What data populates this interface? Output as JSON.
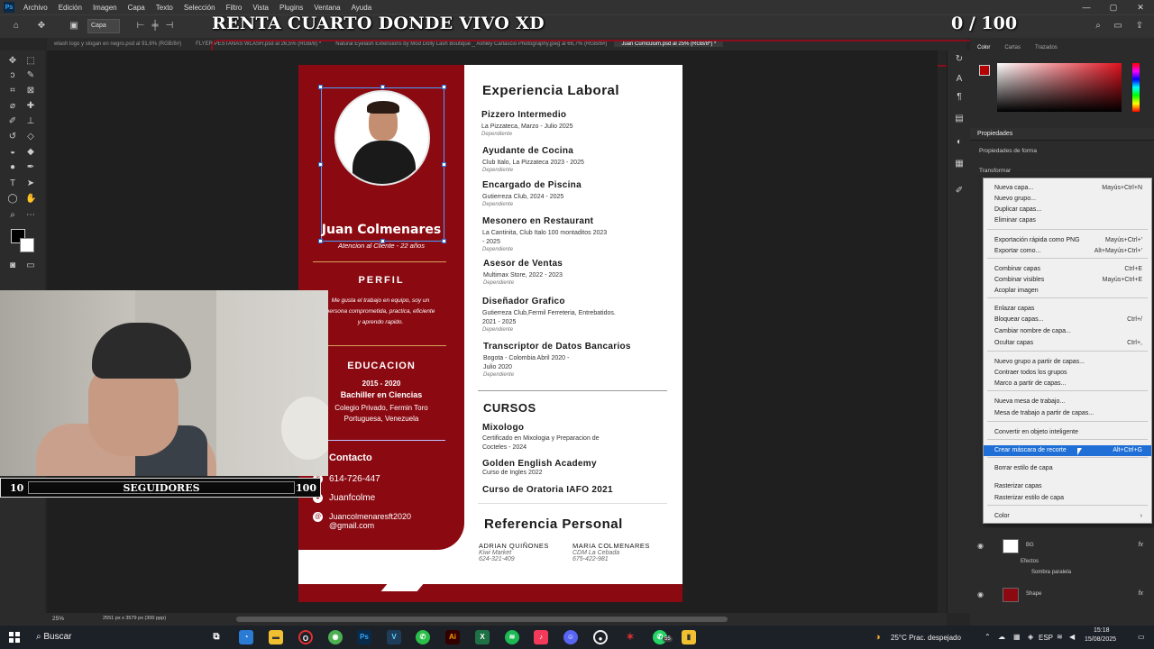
{
  "app": {
    "menu": [
      "Archivo",
      "Edición",
      "Imagen",
      "Capa",
      "Texto",
      "Selección",
      "Filtro",
      "Vista",
      "Plugins",
      "Ventana",
      "Ayuda"
    ],
    "layer_select": "Capa",
    "tabs": [
      "wlash logo y slogan en negro.psd al 91,6% (RGB/8#)",
      "FLYER PESTANAS WLASH.psd al 26,5% (RGB/8) *",
      "Natural Eyelash Extensions by Mod Dolly Lash Boutique _ Ashley Carlascio Photography.jpeg al 66,7% (RGB/8#)",
      "Juan Curriculum.psd al 25% (RGB/8*) *"
    ],
    "status_zoom": "25%",
    "status_doc": "2551 px x 3579 px (300 ppp)"
  },
  "overlay": {
    "title": "RENTA CUARTO DONDE VIVO XD",
    "counter": "0  / 100"
  },
  "stream": {
    "followers_left": "10",
    "followers_label": "SEGUIDORES",
    "followers_right": "100"
  },
  "resume": {
    "name": "Juan Colmenares",
    "role": "Atencion al Cliente - 22 años",
    "perfil_heading": "PERFIL",
    "perfil_text": "Me gusta el trabajo en equipo, soy un persona comprometida, practica, eficiente y aprendo rapido.",
    "edu_heading": "EDUCACION",
    "edu_years": "2015 - 2020",
    "edu_degree": "Bachiller en Ciencias",
    "edu_school": "Colegio Privado, Fermin Toro Portuguesa, Venezuela",
    "contact_heading": "Contacto",
    "phone": "614-726-447",
    "handle": "Juanfcolme",
    "email": "Juancolmenaresft2020 @gmail.com",
    "exp_heading": "Experiencia Laboral",
    "jobs": [
      {
        "title": "Pizzero Intermedio",
        "detail": "La Pizzateca, Marzo - Julio 2025",
        "type": "Dependiente"
      },
      {
        "title": "Ayudante de Cocina",
        "detail": "Club Italo, La Pizzateca 2023 - 2025",
        "type": "Dependiente"
      },
      {
        "title": "Encargado de Piscina",
        "detail": "Gutierreza Club, 2024 - 2025",
        "type": "Dependiente"
      },
      {
        "title": "Mesonero en Restaurant",
        "detail": "La Cantinita, Club Italo 100 montaditos 2023 - 2025",
        "type": "Dependiente"
      },
      {
        "title": "Asesor de Ventas",
        "detail": "Multimax Store, 2022 - 2023",
        "type": "Dependiente"
      },
      {
        "title": "Diseñador Grafico",
        "detail": "Gutierreza Club,Fermil Ferreteria, Entrebatidos. 2021 - 2025",
        "type": "Dependiente"
      },
      {
        "title": "Transcriptor de Datos Bancarios",
        "detail": "Bogota - Colombia Abril 2020 - Julio 2020",
        "type": "Dependiente"
      }
    ],
    "courses_heading": "CURSOS",
    "courses": [
      {
        "title": "Mixologo",
        "detail": "Certificado en Mixologia y Preparacion de Cocteles - 2024"
      },
      {
        "title": "Golden English Academy",
        "detail": "Curso de Ingles 2022"
      },
      {
        "title": "Curso de Oratoria IAFO 2021",
        "detail": ""
      }
    ],
    "ref_heading": "Referencia Personal",
    "refs": [
      {
        "name": "ADRIAN QUIÑONES",
        "place": "Kiwi Market",
        "phone": "624-321-409"
      },
      {
        "name": "MARIA COLMENARES",
        "place": "CDM La Cebada",
        "phone": "675-422-981"
      }
    ]
  },
  "panels": {
    "tabs": [
      "Color",
      "Cartas",
      "Trazados"
    ],
    "properties_title": "Propiedades",
    "properties_sub": "Propiedades de forma",
    "transform": "Transformar",
    "fg_color": "#b30000"
  },
  "context_menu": [
    {
      "label": "Nueva capa...",
      "key": "Mayús+Ctrl+N"
    },
    {
      "label": "Nuevo grupo...",
      "key": ""
    },
    {
      "label": "Duplicar capas...",
      "key": ""
    },
    {
      "label": "Eliminar capas",
      "key": ""
    },
    {
      "label": "Exportación rápida como PNG",
      "key": "Mayús+Ctrl+'"
    },
    {
      "label": "Exportar como...",
      "key": "Alt+Mayús+Ctrl+'"
    },
    {
      "label": "Combinar capas",
      "key": "Ctrl+E"
    },
    {
      "label": "Combinar visibles",
      "key": "Mayús+Ctrl+E"
    },
    {
      "label": "Acoplar imagen",
      "key": ""
    },
    {
      "label": "Enlazar capas",
      "key": ""
    },
    {
      "label": "Bloquear capas...",
      "key": "Ctrl+/"
    },
    {
      "label": "Cambiar nombre de capa...",
      "key": ""
    },
    {
      "label": "Ocultar capas",
      "key": "Ctrl+,"
    },
    {
      "label": "Nuevo grupo a partir de capas...",
      "key": ""
    },
    {
      "label": "Contraer todos los grupos",
      "key": ""
    },
    {
      "label": "Marco a partir de capas...",
      "key": ""
    },
    {
      "label": "Nueva mesa de trabajo...",
      "key": ""
    },
    {
      "label": "Mesa de trabajo a partir de capas...",
      "key": ""
    },
    {
      "label": "Convertir en objeto inteligente",
      "key": ""
    },
    {
      "label": "Crear máscara de recorte",
      "key": "Alt+Ctrl+G"
    },
    {
      "label": "Borrar estilo de capa",
      "key": ""
    },
    {
      "label": "Rasterizar capas",
      "key": ""
    },
    {
      "label": "Rasterizar estilo de capa",
      "key": ""
    },
    {
      "label": "Color",
      "key": "›"
    }
  ],
  "layers": [
    {
      "name": "BG",
      "fx": "fx"
    },
    {
      "name": "Efectos",
      "fx": ""
    },
    {
      "name": "Sombra paralela",
      "fx": ""
    },
    {
      "name": "Shape",
      "fx": "fx"
    }
  ],
  "taskbar": {
    "search": "Buscar",
    "weather": "25°C  Prac. despejado",
    "lang": "ESP",
    "time": "15:18",
    "date": "15/08/2025",
    "badge": "55"
  }
}
